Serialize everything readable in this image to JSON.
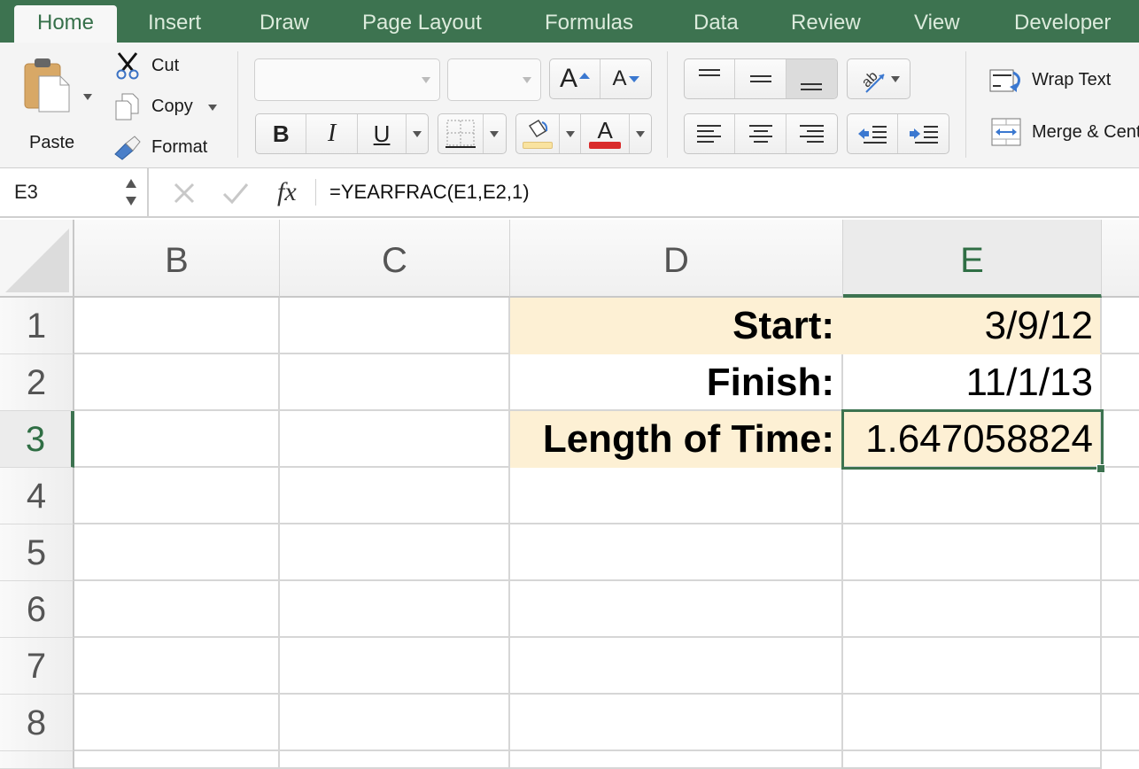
{
  "tabs": [
    {
      "label": "Home",
      "active": true
    },
    {
      "label": "Insert"
    },
    {
      "label": "Draw"
    },
    {
      "label": "Page Layout"
    },
    {
      "label": "Formulas"
    },
    {
      "label": "Data"
    },
    {
      "label": "Review"
    },
    {
      "label": "View"
    },
    {
      "label": "Developer"
    }
  ],
  "ribbon": {
    "paste_label": "Paste",
    "cut_label": "Cut",
    "copy_label": "Copy",
    "format_label": "Format",
    "font_name": "",
    "font_size": "",
    "bold_glyph": "B",
    "italic_glyph": "I",
    "underline_glyph": "U",
    "font_color_glyph": "A",
    "increase_font_glyph": "A",
    "decrease_font_glyph": "A",
    "wrap_text_label": "Wrap Text",
    "merge_center_label": "Merge & Center",
    "fill_color": "#f9e3a0",
    "font_color": "#d92b2b"
  },
  "formula_bar": {
    "name_box": "E3",
    "fx_label": "fx",
    "formula": "=YEARFRAC(E1,E2,1)"
  },
  "sheet": {
    "columns": [
      "B",
      "C",
      "D",
      "E"
    ],
    "selected_column": "E",
    "rows": [
      "1",
      "2",
      "3",
      "4",
      "5",
      "6",
      "7",
      "8"
    ],
    "selected_row": "3",
    "selected_cell": "E3",
    "cells": {
      "D1": "Start:",
      "E1": "3/9/12",
      "D2": "Finish:",
      "E2": "11/1/13",
      "D3": "Length of Time:",
      "E3": "1.647058824"
    },
    "highlight_color": "#fdf0d4",
    "accent_color": "#3d7350"
  }
}
